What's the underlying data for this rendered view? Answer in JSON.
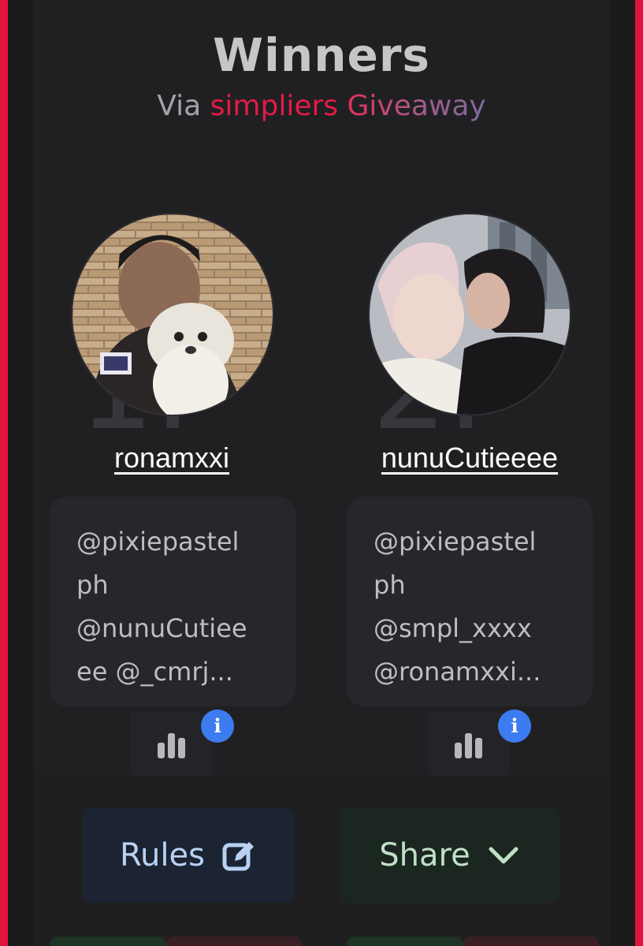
{
  "header": {
    "title": "Winners",
    "subtitle_prefix": "Via",
    "subtitle_brand": "simpliers",
    "subtitle_suffix": "Giveaway"
  },
  "winners": [
    {
      "rank": "1.",
      "username": "ronamxxi",
      "avatar_icon": "profile-photo",
      "tags": [
        "@pixiepastel",
        "ph",
        "@nunuCutiee",
        "ee @_cmrj..."
      ]
    },
    {
      "rank": "2.",
      "username": "nunuCutieeee",
      "avatar_icon": "profile-photo",
      "tags": [
        "@pixiepastel",
        "ph",
        "@smpl_xxxx",
        "@ronamxxi..."
      ]
    }
  ],
  "buttons": {
    "rules_label": "Rules",
    "share_label": "Share"
  },
  "icons": {
    "stats": "bar-chart-icon",
    "info": "i",
    "rules": "edit-icon",
    "share": "chevron-down-icon"
  },
  "colors": {
    "frame": "#e0143c",
    "brand": "#e31b45",
    "info_badge": "#3c7cf0",
    "rules_bg": "#1c2434",
    "share_bg": "#1b2620"
  }
}
